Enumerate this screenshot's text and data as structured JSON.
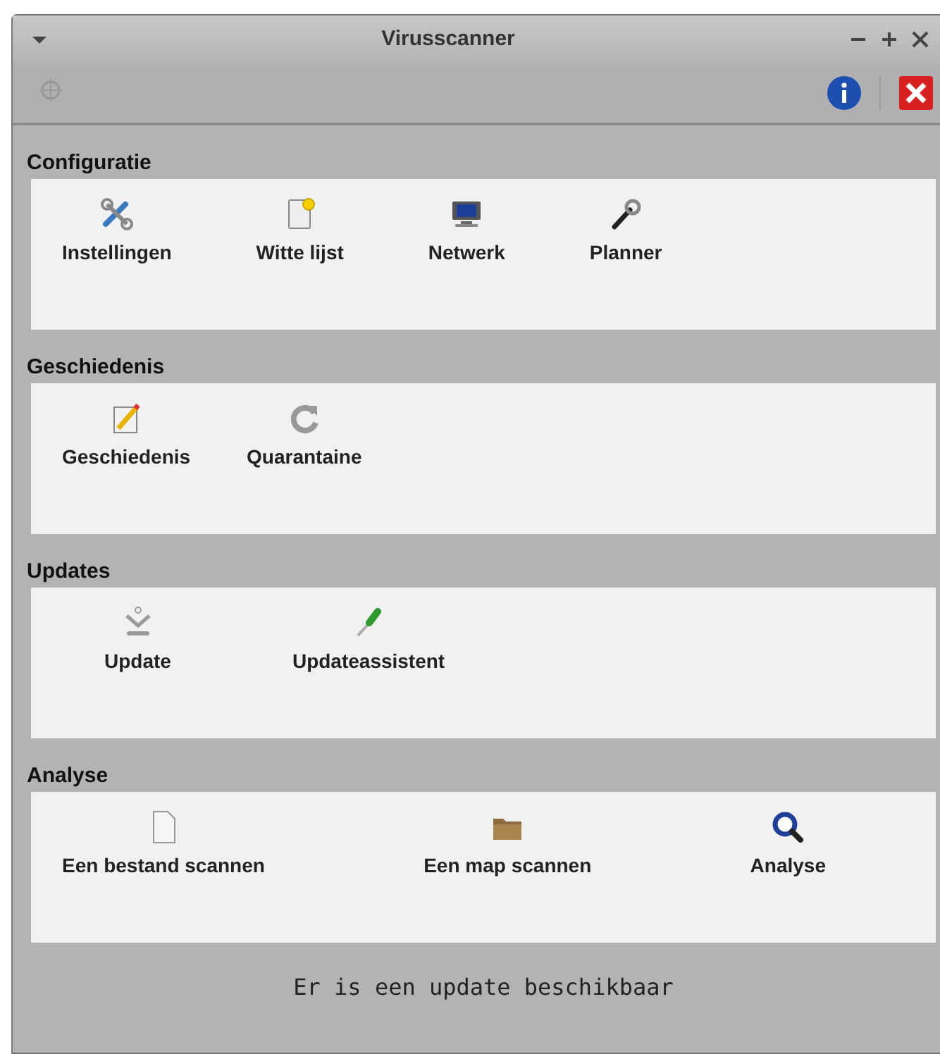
{
  "window": {
    "title": "Virusscanner"
  },
  "sections": [
    {
      "title": "Configuratie",
      "items": [
        {
          "label": "Instellingen",
          "kind": "tools"
        },
        {
          "label": "Witte lijst",
          "kind": "note"
        },
        {
          "label": "Netwerk",
          "kind": "network"
        },
        {
          "label": "Planner",
          "kind": "wrench"
        }
      ]
    },
    {
      "title": "Geschiedenis",
      "items": [
        {
          "label": "Geschiedenis",
          "kind": "pencil"
        },
        {
          "label": "Quarantaine",
          "kind": "reload"
        }
      ]
    },
    {
      "title": "Updates",
      "items": [
        {
          "label": "Update",
          "kind": "download"
        },
        {
          "label": "Updateassistent",
          "kind": "dropper"
        }
      ]
    },
    {
      "title": "Analyse",
      "items": [
        {
          "label": "Een bestand scannen",
          "kind": "file"
        },
        {
          "label": "Een map scannen",
          "kind": "folder"
        },
        {
          "label": "Analyse",
          "kind": "magnifier"
        }
      ]
    }
  ],
  "status_bar": "Er is een update beschikbaar"
}
